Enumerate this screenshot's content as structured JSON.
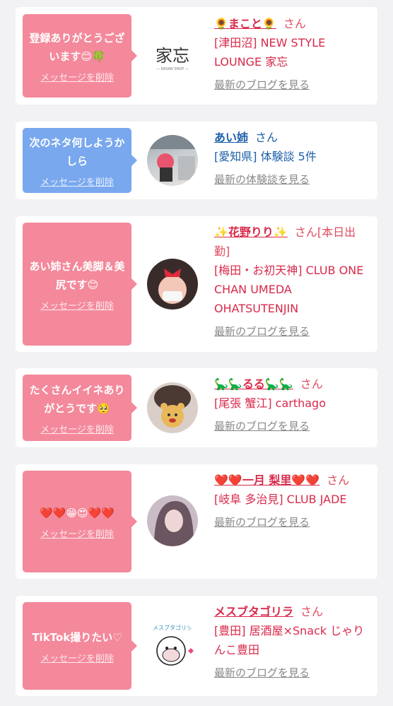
{
  "cards": [
    {
      "message": "登録ありがとうございます😊🍀",
      "delete_label": "メッセージを削除",
      "name": "🌻まこと🌻",
      "san": "さん",
      "shop": "[津田沼] NEW STYLE LOUNGE 家忘",
      "link": "最新のブログを見る",
      "avatar_text": "家忘",
      "avatar_sub": "— KASAN SHOP —"
    },
    {
      "message": "次のネタ何しようかしら",
      "delete_label": "メッセージを削除",
      "name": "あい姉",
      "san": "さん",
      "shop": "[愛知県] 体験談 5件",
      "link": "最新の体験談を見る"
    },
    {
      "message": "あい姉さん美脚＆美尻です😊",
      "delete_label": "メッセージを削除",
      "name": "✨花野りり✨",
      "san": "さん[本日出勤]",
      "shop": "[梅田・お初天神] CLUB ONE CHAN UMEDA OHATSUTENJIN",
      "link": "最新のブログを見る"
    },
    {
      "message": "たくさんイイネありがとうです🥺",
      "delete_label": "メッセージを削除",
      "name": "🦕🦕るる🦕🦕",
      "san": "さん",
      "shop": "[尾張 蟹江] carthago",
      "link": "最新のブログを見る"
    },
    {
      "message": "❤️❤️😁😍❤️❤️",
      "delete_label": "メッセージを削除",
      "name": "❤️❤️一月 梨里❤️❤️",
      "san": "さん",
      "shop": "[岐阜 多治見] CLUB JADE",
      "link": "最新のブログを見る"
    },
    {
      "message": "TikTok撮りたい♡",
      "delete_label": "メッセージを削除",
      "name": "メスブタゴリラ",
      "san": "さん",
      "shop": "[豊田] 居酒屋×Snack じゃりんこ豊田",
      "link": "最新のブログを見る",
      "avatar_text": "メスブタゴリラ"
    }
  ],
  "colors": {
    "pink_bubble": "#f3899b",
    "blue_bubble": "#79a8ee",
    "name_red": "#d8294a",
    "name_blue": "#1c5fa8",
    "link_gray": "#888888"
  }
}
